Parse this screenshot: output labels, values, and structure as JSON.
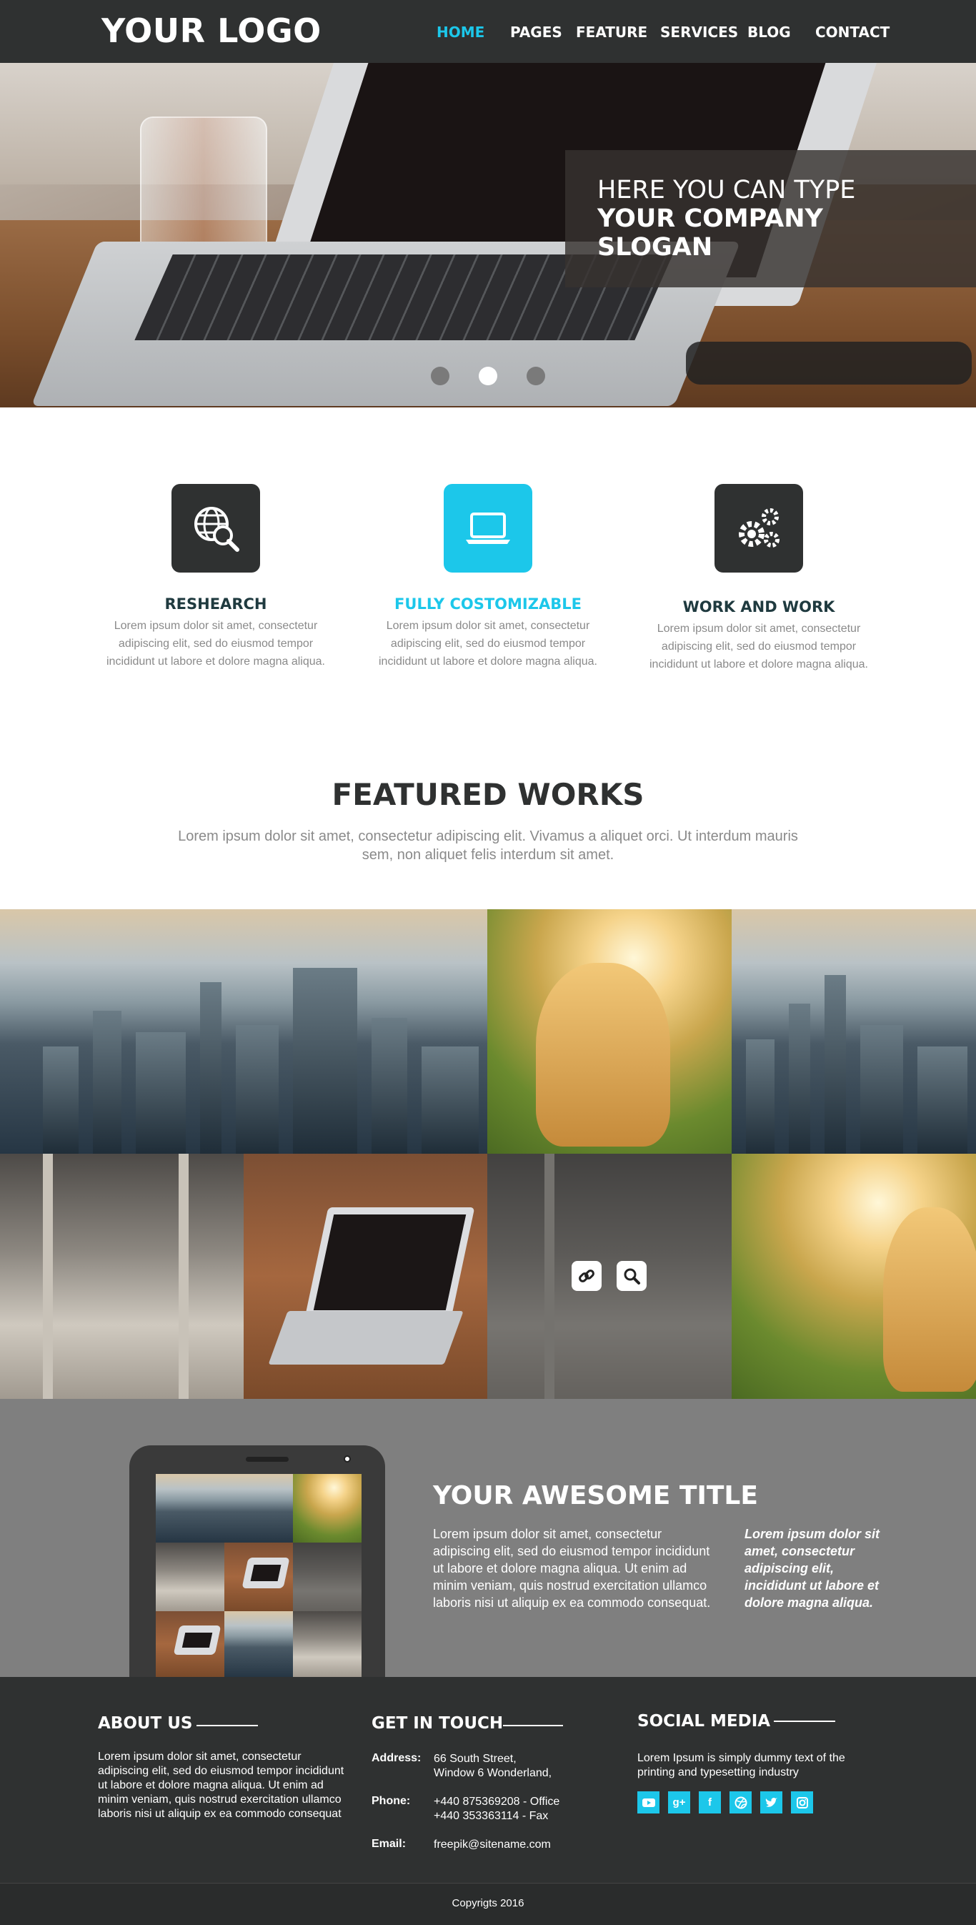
{
  "header": {
    "logo": "YOUR LOGO",
    "menu": [
      {
        "label": "HOME",
        "active": true
      },
      {
        "label": "PAGES",
        "active": false
      },
      {
        "label": "FEATURE",
        "active": false
      },
      {
        "label": "SERVICES",
        "active": false
      },
      {
        "label": "BLOG",
        "active": false
      },
      {
        "label": "CONTACT",
        "active": false
      }
    ]
  },
  "hero": {
    "slogan_line1": "HERE YOU CAN TYPE",
    "slogan_line2": "YOUR COMPANY SLOGAN",
    "slides": 3,
    "active_slide": 2
  },
  "features": [
    {
      "title": "RESHEARCH",
      "icon": "globe-search-icon",
      "text": "Lorem ipsum dolor sit amet, consectetur adipiscing elit, sed do eiusmod tempor incididunt ut labore et dolore magna aliqua."
    },
    {
      "title": "FULLY COSTOMIZABLE",
      "icon": "laptop-icon",
      "text": "Lorem ipsum dolor sit amet, consectetur adipiscing elit, sed do eiusmod tempor incididunt ut labore et dolore magna aliqua."
    },
    {
      "title": "WORK AND WORK",
      "icon": "gears-icon",
      "text": "Lorem ipsum dolor sit amet, consectetur adipiscing elit, sed do eiusmod tempor incididunt ut labore et dolore magna aliqua."
    }
  ],
  "featured_works": {
    "title": "FEATURED WORKS",
    "subtitle": "Lorem ipsum dolor sit amet, consectetur adipiscing elit. Vivamus a aliquet orci. Ut interdum mauris sem, non aliquet felis interdum sit amet."
  },
  "promo": {
    "title": "YOUR AWESOME TITLE",
    "text": "Lorem ipsum dolor sit amet, consectetur adipiscing elit, sed do eiusmod tempor incididunt ut labore et dolore magna aliqua. Ut enim ad minim veniam, quis nostrud exercitation ullamco laboris nisi ut aliquip ex ea commodo consequat.",
    "quote": "Lorem ipsum dolor sit amet, consectetur adipiscing elit, incididunt ut labore et dolore magna aliqua."
  },
  "footer": {
    "about": {
      "title": "ABOUT US",
      "text": "Lorem ipsum dolor sit amet, consectetur adipiscing elit, sed do eiusmod tempor incididunt ut labore et dolore magna aliqua. Ut enim ad minim veniam, quis nostrud exercitation ullamco laboris nisi ut aliquip ex ea commodo consequat"
    },
    "contact": {
      "title": "GET IN TOUCH",
      "address_label": "Address:",
      "address_line1": "66 South Street,",
      "address_line2": "Window 6 Wonderland,",
      "phone_label": "Phone:",
      "phone_line1": "+440 875369208 - Office",
      "phone_line2": "+440 353363114 - Fax",
      "email_label": "Email:",
      "email": "freepik@sitename.com"
    },
    "social": {
      "title": "SOCIAL MEDIA",
      "text": "Lorem Ipsum is simply dummy text of the printing and typesetting industry",
      "icons": [
        "youtube-icon",
        "google-plus-icon",
        "facebook-icon",
        "dribbble-icon",
        "twitter-icon",
        "instagram-icon"
      ]
    },
    "copyright": "Copyrigts 2016"
  },
  "colors": {
    "accent": "#1cc7ea",
    "dark": "#2f3131",
    "promo_bg": "#7f7f7f"
  }
}
